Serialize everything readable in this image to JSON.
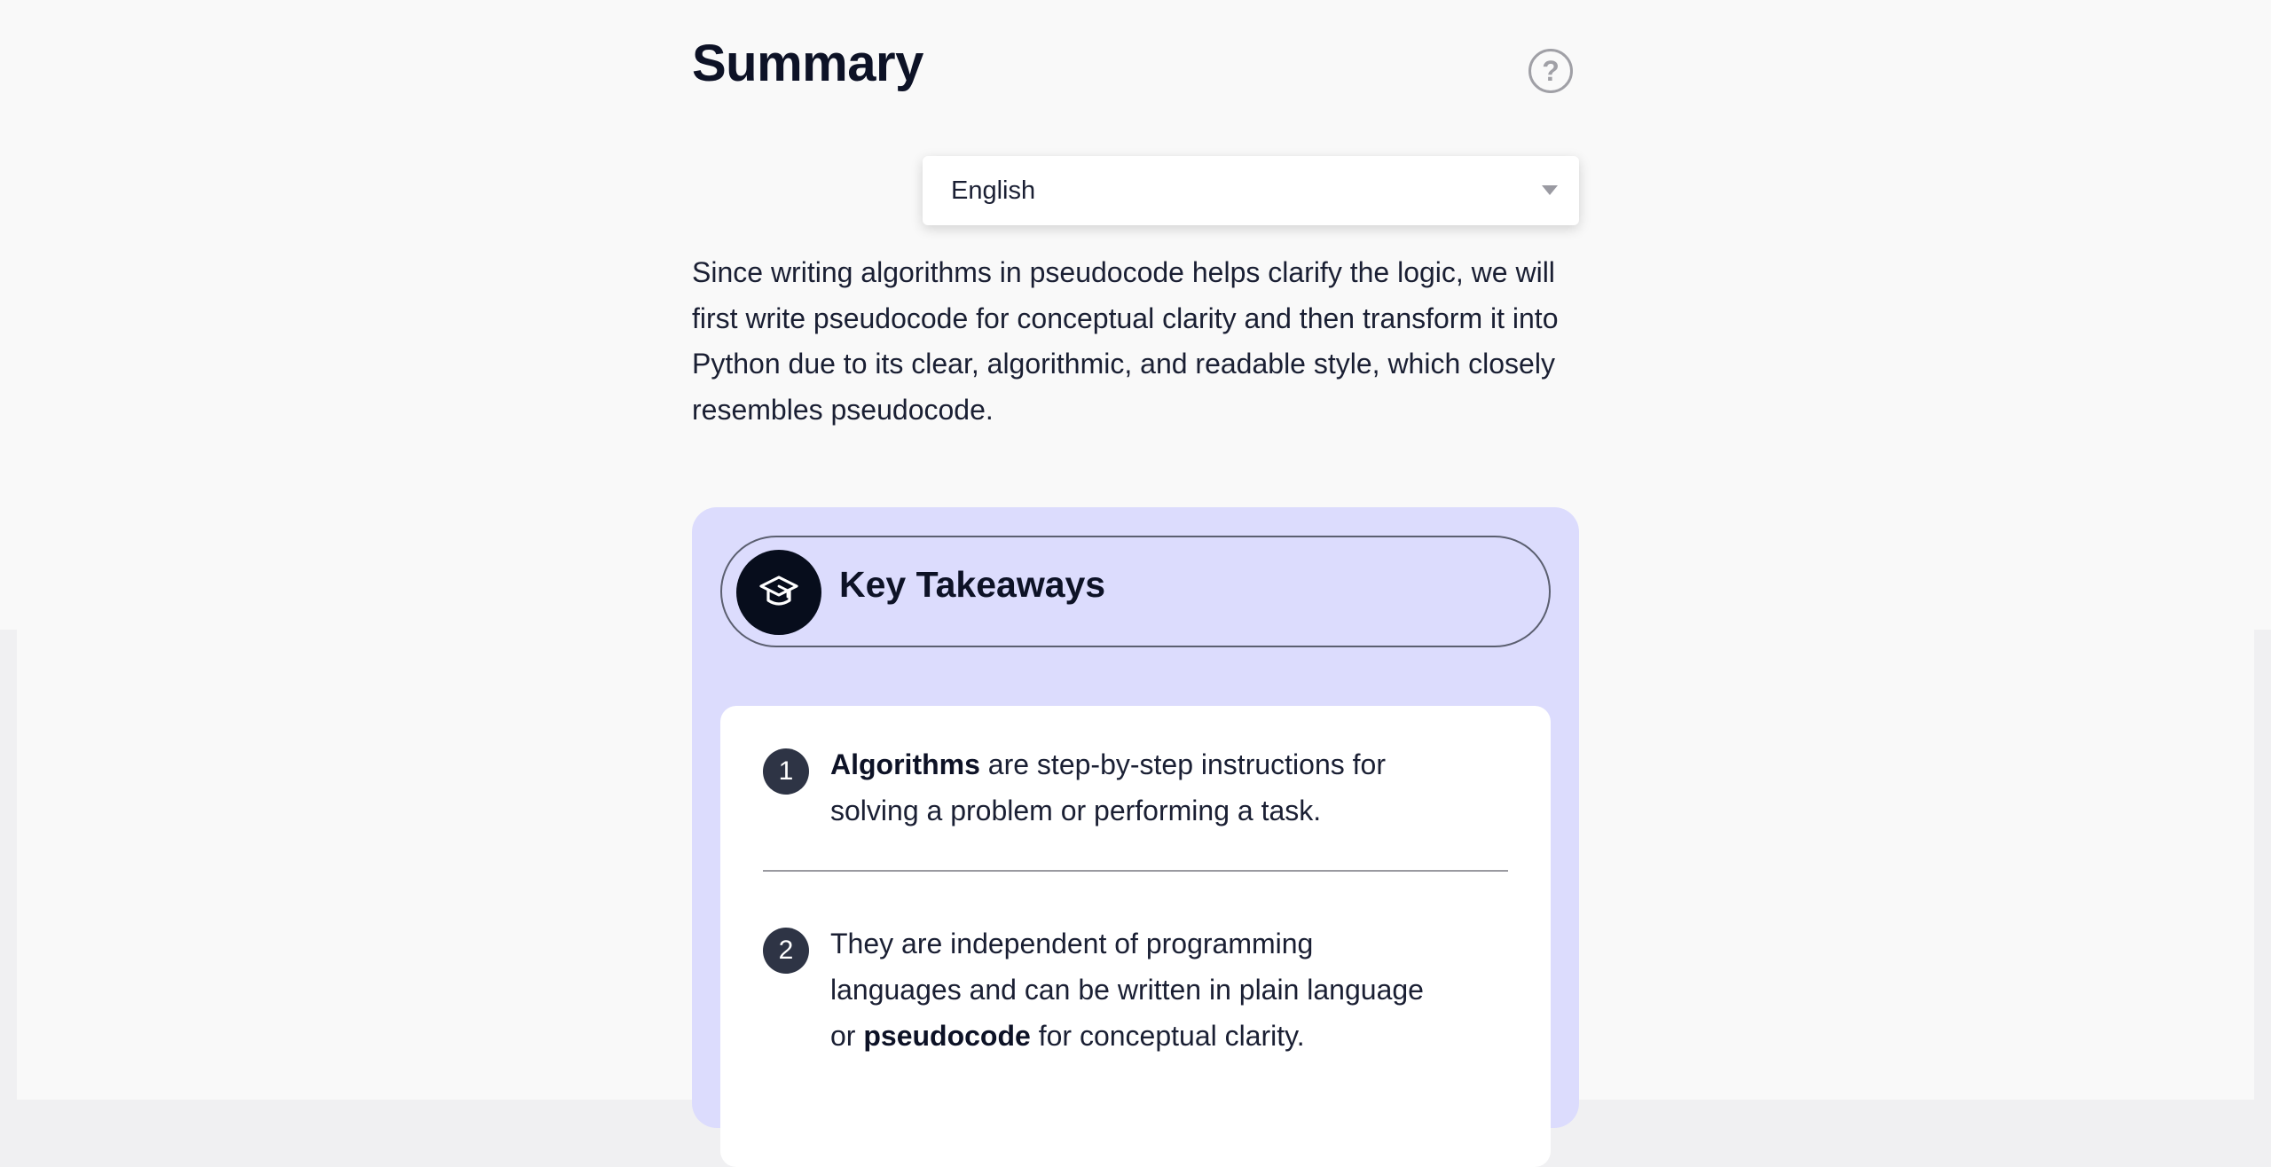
{
  "page": {
    "title": "Summary",
    "help_icon": "question-circle-icon",
    "help_glyph": "?"
  },
  "language_select": {
    "selected": "English",
    "caret_icon": "caret-down-icon"
  },
  "summary": {
    "text": "Since writing algorithms in pseudocode helps clarify the logic, we will first write pseudocode for conceptual clarity and then transform it into Python due to its clear, algorithmic, and readable style, which closely resembles pseudocode."
  },
  "takeaways": {
    "title": "Key Takeaways",
    "icon": "graduation-cap-icon",
    "colors": {
      "card_bg": "#dcdcfd",
      "icon_bg": "#070d1c",
      "badge_bg": "#2e3445"
    },
    "items": [
      {
        "number": "1",
        "bold": "Algorithms",
        "rest": " are step-by-step instructions for solving a problem or performing a task."
      },
      {
        "number": "2",
        "before": "They are independent of programming languages and can be written in plain language or ",
        "bold": "pseudocode",
        "after": " for conceptual clarity."
      }
    ]
  }
}
